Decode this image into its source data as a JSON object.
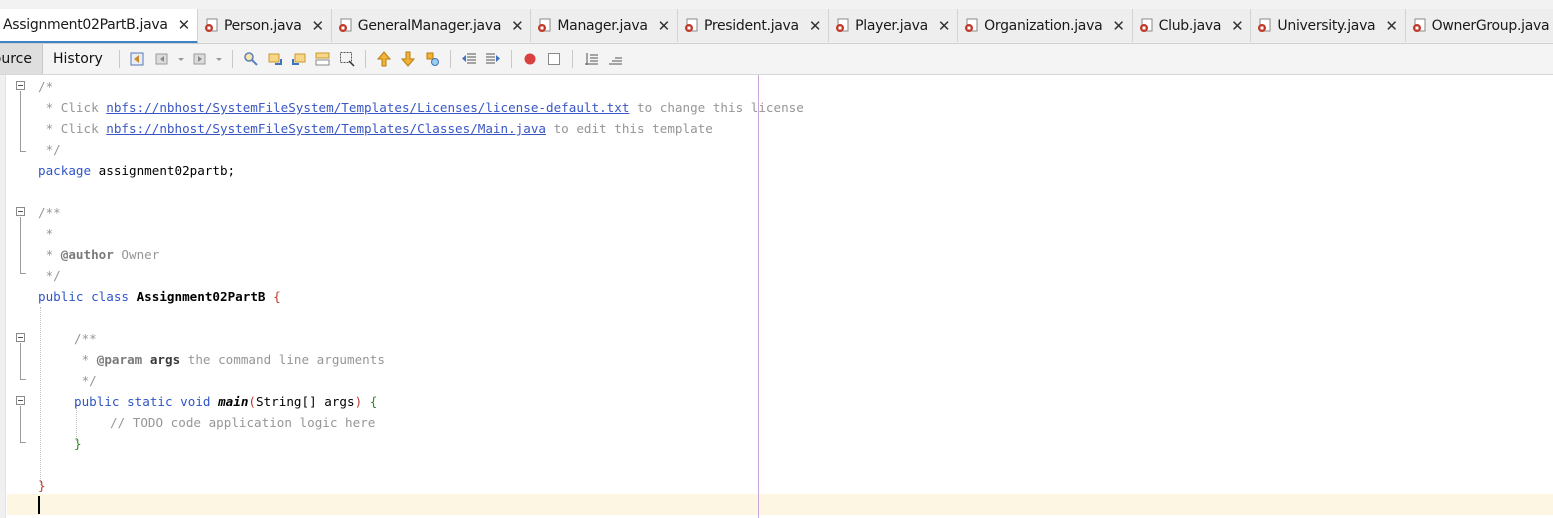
{
  "tabs": [
    {
      "label": "Assignment02PartB.java",
      "active": true
    },
    {
      "label": "Person.java"
    },
    {
      "label": "GeneralManager.java"
    },
    {
      "label": "Manager.java"
    },
    {
      "label": "President.java"
    },
    {
      "label": "Player.java"
    },
    {
      "label": "Organization.java"
    },
    {
      "label": "Club.java"
    },
    {
      "label": "University.java"
    },
    {
      "label": "OwnerGroup.java"
    }
  ],
  "close_glyph": "✕",
  "toolbar": {
    "source_label": "Source",
    "history_label": "History"
  },
  "code": {
    "l1": "/*",
    "l2_pre": " * Click ",
    "l2_link": "nbfs://nbhost/SystemFileSystem/Templates/Licenses/license-default.txt",
    "l2_post": " to change this license",
    "l3_pre": " * Click ",
    "l3_link": "nbfs://nbhost/SystemFileSystem/Templates/Classes/Main.java",
    "l3_post": " to edit this template",
    "l4": " */",
    "l5_kw": "package",
    "l5_rest": " assignment02partb;",
    "l7": "/**",
    "l8": " *",
    "l9_pre": " * ",
    "l9_tag": "@author",
    "l9_post": " Owner",
    "l10": " */",
    "l11_kw": "public class",
    "l11_name": "Assignment02PartB",
    "l11_brace": "{",
    "l13": "/**",
    "l14_pre": " * ",
    "l14_tag": "@param",
    "l14_arg": "args",
    "l14_post": " the command line arguments",
    "l15": " */",
    "l16_kw": "public static void",
    "l16_name": "main",
    "l16_sig_open": "(",
    "l16_sig": "String[] args",
    "l16_sig_close": ")",
    "l16_brace": "{",
    "l17": "// TODO code application logic here",
    "l18": "}",
    "l20": "}"
  },
  "colors": {
    "accent_tab_underline": "#3d83c6",
    "keyword": "#2f55c8",
    "comment": "#969696",
    "current_line": "#fdf6e3",
    "margin_line": "#c9a6d9"
  }
}
